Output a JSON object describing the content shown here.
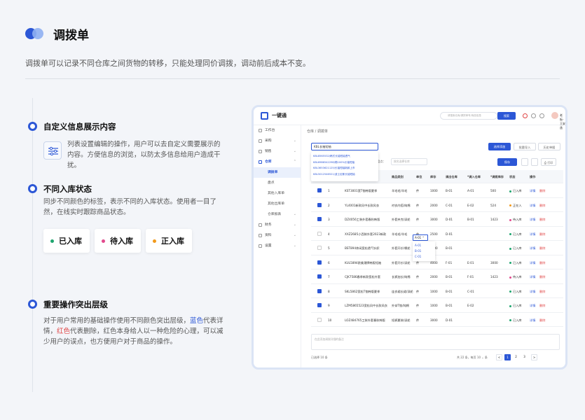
{
  "header": {
    "title": "调拨单",
    "description": "调拨单可以记录不同仓库之间货物的转移，只能处理同价调拨，调动前后成本不变。"
  },
  "sections": [
    {
      "title": "自定义信息展示内容",
      "text": "列表设置编辑的操作，用户可以去自定义需要展示的内容。方便信息的浏览，以防太多信息给用户造成干扰。"
    },
    {
      "title": "不同入库状态",
      "text": "同步不同颜色的标签，表示不同的入库状态。使用者一目了然，在线实时跟踪商品状态。"
    },
    {
      "title": "重要操作突出层级",
      "text_a": "对于用户常用的基础操作使用不同颜色突出层级，",
      "text_blue": "蓝色",
      "text_b": "代表详情，",
      "text_red": "红色",
      "text_c": "代表删除，红色本身给人以一种危险的心理，可以减少用户的误点，也方便用户对于商品的操作。"
    }
  ],
  "badges": [
    {
      "label": "已入库",
      "color": "#1fa56f"
    },
    {
      "label": "待入库",
      "color": "#e24a8d"
    },
    {
      "label": "正入库",
      "color": "#f29a1c"
    }
  ],
  "app": {
    "logo": "一键通",
    "search_placeholder": "请搜索仓库/调拨单号/商品信息",
    "search_btn": "搜索",
    "user": "老板-王安逸",
    "side": [
      {
        "label": "工作台",
        "chev": ""
      },
      {
        "label": "采购",
        "chev": "⌄"
      },
      {
        "label": "销售",
        "chev": "⌄"
      },
      {
        "label": "仓库",
        "chev": "⌃",
        "active": true
      },
      {
        "label": "调拨单",
        "sub": true,
        "active": true
      },
      {
        "label": "盘点",
        "sub": true
      },
      {
        "label": "其他入库单",
        "sub": true
      },
      {
        "label": "其他出库单",
        "sub": true
      },
      {
        "label": "仓库报表",
        "sub": true,
        "chev": "⌄"
      },
      {
        "label": "财务",
        "chev": "⌄"
      },
      {
        "label": "资料",
        "chev": "⌄"
      },
      {
        "label": "设置",
        "chev": "⌄"
      }
    ],
    "breadcrumb": "仓库 / 调拨单",
    "input_value": "KBL长袖短袖",
    "dropdown": [
      "KBL8565532/韩式长袖短袖透气",
      "KBL6986542298/棉100%长袖短袖",
      "KBL3653621125/长袖短袖新款上市",
      "KBL5012546521/波士尼斯长袖短袖"
    ],
    "buttons": {
      "add": "选择添加",
      "import": "批量导入",
      "history": "历史单据",
      "save": "保存"
    },
    "filter_label": "盘盘点：",
    "filter_placeholder": "按名选择仓库",
    "columns": [
      "商品名称",
      "商品类别",
      "单位",
      "库存",
      "调出仓库",
      "*调入仓库",
      "*调拨库存",
      "状态",
      "操作"
    ],
    "rows": [
      {
        "n": "1",
        "checked": true,
        "name": "KST3001宽T恤韩版夏季",
        "cat": "羊毛毛/羊毛",
        "unit": "件",
        "stock": "1000",
        "out": "B-01",
        "in": "A-01",
        "qty": "500",
        "status": "已入库",
        "sc": "#1fa56f"
      },
      {
        "n": "2",
        "checked": true,
        "name": "YL4001新款风中长款风衣",
        "cat": "衬衣内搭/纯棉",
        "unit": "件",
        "stock": "2000",
        "out": "C-01",
        "in": "E-02",
        "qty": "524",
        "status": "正在入",
        "sc": "#f29a1c"
      },
      {
        "n": "3",
        "checked": true,
        "name": "DZ4056工装外套春秋韩版",
        "cat": "外套夹克/涤纶",
        "unit": "件",
        "stock": "3000",
        "out": "D-01",
        "in": "B-01",
        "qty": "1423",
        "status": "待入库",
        "sc": "#e24a8d"
      },
      {
        "n": "4",
        "checked": false,
        "name": "XXZ2685小西装外套2023新款",
        "cat": "羊毛毛/羊毛",
        "unit": "件",
        "stock": "2500",
        "out": "D-01",
        "in": "A-01",
        "qty": "",
        "status": "已入库",
        "sc": "#1fa56f"
      },
      {
        "n": "5",
        "checked": false,
        "name": "BST894休闲宽松透气针织",
        "cat": "外套开衫/棉纶",
        "unit": "件",
        "stock": "1000",
        "out": "B-01",
        "in": "",
        "qty": "",
        "status": "已入库",
        "sc": "#1fa56f"
      },
      {
        "n": "6",
        "checked": true,
        "name": "KUL5894欧美潮牌韩版短袖",
        "cat": "外套开衫/涤纶",
        "unit": "件",
        "stock": "4000",
        "out": "F-01",
        "in": "E-01",
        "qty": "3000",
        "status": "已入库",
        "sc": "#1fa56f"
      },
      {
        "n": "7",
        "checked": true,
        "name": "CJK7586春季新款宽松外套",
        "cat": "长裤加长/纯棉",
        "unit": "件",
        "stock": "2000",
        "out": "B-01",
        "in": "F-01",
        "qty": "1423",
        "status": "待入库",
        "sc": "#e24a8d"
      },
      {
        "n": "8",
        "checked": true,
        "name": "SKL5862宽松T恤韩版夏季",
        "cat": "连衣裙长裙/涤纶",
        "unit": "件",
        "stock": "1000",
        "out": "B-01",
        "in": "C-01",
        "qty": "",
        "status": "已入库",
        "sc": "#1fa56f"
      },
      {
        "n": "9",
        "checked": true,
        "name": "LZM5865523宽松风中长款风衣",
        "cat": "外穿T恤/纯棉",
        "unit": "件",
        "stock": "1000",
        "out": "B-01",
        "in": "E-02",
        "qty": "",
        "status": "已入库",
        "sc": "#1fa56f"
      },
      {
        "n": "10",
        "checked": false,
        "name": "LOZ484765工装外套春秋韩版",
        "cat": "短裤夏装/涤纶",
        "unit": "件",
        "stock": "3000",
        "out": "D-01",
        "in": "",
        "qty": "",
        "status": "已入库",
        "sc": "#1fa56f"
      }
    ],
    "detail": "详情",
    "delete": "删除",
    "inline_select": "A-01 ⌃",
    "inline_options": [
      "A-01",
      "B-01",
      "C-01"
    ],
    "remark_placeholder": "在此添加调拨详细的备注",
    "selected": "已选择 10 条",
    "pager": "共 22 条，每页 10 ⌄ 条",
    "pages": [
      "1",
      "2",
      "3"
    ],
    "next": ">",
    "prev": "<"
  }
}
